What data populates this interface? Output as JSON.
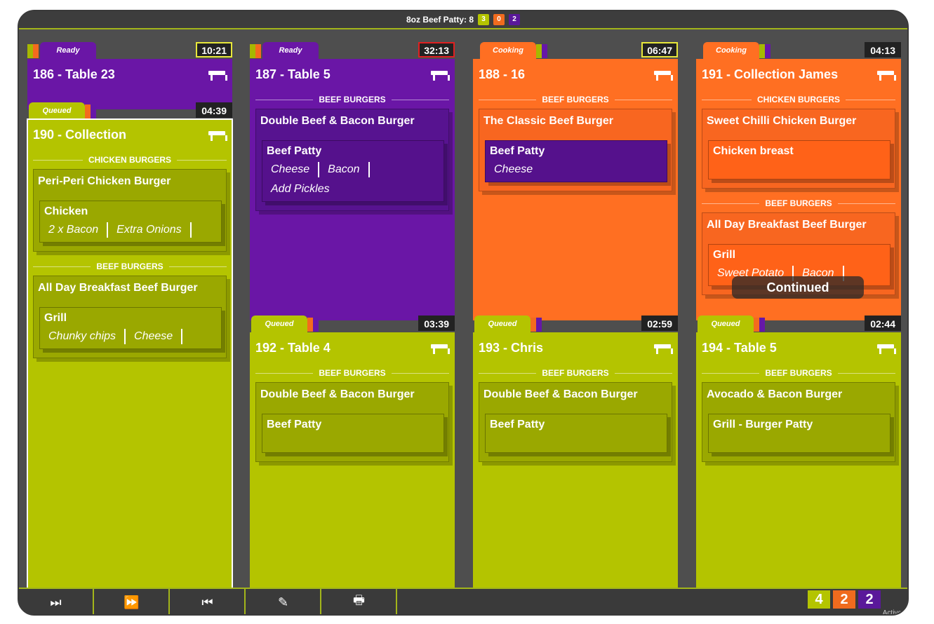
{
  "topbar": {
    "summary": "8oz Beef Patty: 8",
    "counts": [
      "3",
      "0",
      "2"
    ]
  },
  "tickets": [
    {
      "id": "t186",
      "status": "Ready",
      "timer": "10:21",
      "title": "186 - Table 23",
      "items": []
    },
    {
      "id": "t187",
      "status": "Ready",
      "timer": "32:13",
      "title": "187 - Table 5",
      "items": [
        {
          "category": "BEEF BURGERS",
          "name": "Double Beef & Bacon Burger",
          "mod": "Beef Patty",
          "options": [
            "Cheese",
            "Bacon",
            "Add Pickles"
          ]
        }
      ]
    },
    {
      "id": "t188",
      "status": "Cooking",
      "timer": "06:47",
      "title": "188 - 16",
      "items": [
        {
          "category": "BEEF BURGERS",
          "name": "The Classic Beef Burger",
          "mod": "Beef Patty",
          "options": [
            "Cheese"
          ]
        }
      ]
    },
    {
      "id": "t191",
      "status": "Cooking",
      "timer": "04:13",
      "title": "191 - Collection James",
      "items": [
        {
          "category": "CHICKEN BURGERS",
          "name": "Sweet Chilli Chicken Burger",
          "mod": "Chicken breast",
          "options": []
        },
        {
          "category": "BEEF BURGERS",
          "name": "All Day Breakfast Beef Burger",
          "mod": "Grill",
          "options": [
            "Sweet Potato",
            "Bacon"
          ]
        }
      ]
    },
    {
      "id": "t190",
      "status": "Queued",
      "timer": "04:39",
      "title": "190 - Collection",
      "items": [
        {
          "category": "CHICKEN BURGERS",
          "name": "Peri-Peri Chicken Burger",
          "mod": "Chicken",
          "options": [
            "2 x Bacon",
            "Extra Onions"
          ]
        },
        {
          "category": "BEEF BURGERS",
          "name": "All Day Breakfast Beef Burger",
          "mod": "Grill",
          "options": [
            "Chunky chips",
            "Cheese"
          ]
        }
      ]
    },
    {
      "id": "t192",
      "status": "Queued",
      "timer": "03:39",
      "title": "192 - Table 4",
      "items": [
        {
          "category": "BEEF BURGERS",
          "name": "Double Beef & Bacon Burger",
          "mod": "Beef Patty",
          "options": []
        }
      ]
    },
    {
      "id": "t193",
      "status": "Queued",
      "timer": "02:59",
      "title": "193 - Chris",
      "items": [
        {
          "category": "BEEF BURGERS",
          "name": "Double Beef & Bacon Burger",
          "mod": "Beef Patty",
          "options": []
        }
      ]
    },
    {
      "id": "t194",
      "status": "Queued",
      "timer": "02:44",
      "title": "194 - Table 5",
      "items": [
        {
          "category": "BEEF BURGERS",
          "name": "Avocado & Bacon Burger",
          "mod": "Grill - Burger Patty",
          "options": []
        }
      ]
    }
  ],
  "overlay": {
    "continued": "Continued"
  },
  "toolbar": {
    "buttons": [
      {
        "name": "bump-icon",
        "glyph": "⏭"
      },
      {
        "name": "bump-all-icon",
        "glyph": "⏩"
      },
      {
        "name": "recall-icon",
        "glyph": "⏮"
      },
      {
        "name": "edit-icon",
        "glyph": "✎"
      },
      {
        "name": "print-icon",
        "glyph": "🖶"
      }
    ]
  },
  "footer": {
    "counts": [
      "4",
      "2",
      "2"
    ],
    "active_label": "Active"
  },
  "colors": {
    "queued": "#b4c400",
    "cooking": "#ff6f22",
    "ready": "#6a16a6",
    "accent": "#a3b51a"
  }
}
